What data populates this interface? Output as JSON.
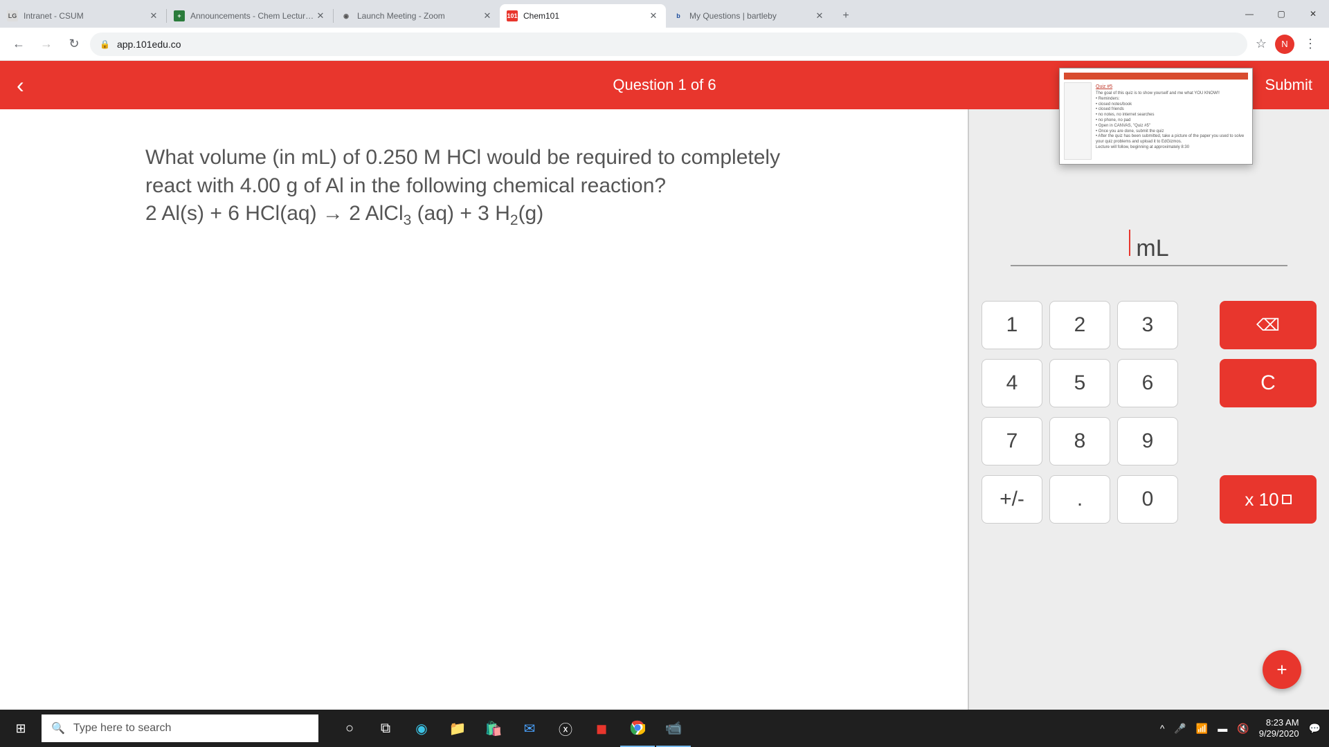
{
  "browser": {
    "tabs": [
      {
        "favicon": "LG",
        "title": "Intranet - CSUM",
        "fav_bg": "#ddd",
        "fav_color": "#555"
      },
      {
        "favicon": "+",
        "title": "Announcements - Chem Lecture…",
        "fav_bg": "#2a7b3b",
        "fav_color": "#fff"
      },
      {
        "favicon": "◉",
        "title": "Launch Meeting - Zoom",
        "fav_bg": "transparent",
        "fav_color": "#555"
      },
      {
        "favicon": "101",
        "title": "Chem101",
        "fav_bg": "#e8362d",
        "fav_color": "#fff"
      },
      {
        "favicon": "b",
        "title": "My Questions | bartleby",
        "fav_bg": "transparent",
        "fav_color": "#1a4b9c"
      }
    ],
    "active_tab": 3,
    "url": "app.101edu.co",
    "profile_letter": "N"
  },
  "header": {
    "counter": "Question 1 of 6",
    "submit": "Submit"
  },
  "question": {
    "line1": "What volume (in mL) of 0.250 M HCl would be required to completely",
    "line2": "react with 4.00 g of Al in the following chemical reaction?",
    "eq_a": "2 Al(s) + 6 HCl(aq) → 2 AlCl",
    "eq_sub1": "3",
    "eq_b": " (aq) + 3 H",
    "eq_sub2": "2",
    "eq_c": "(g)"
  },
  "answer": {
    "unit": "mL",
    "value": ""
  },
  "keypad": {
    "k1": "1",
    "k2": "2",
    "k3": "3",
    "k4": "4",
    "k5": "5",
    "k6": "6",
    "k7": "7",
    "k8": "8",
    "k9": "9",
    "k0": "0",
    "pm": "+/-",
    "dot": ".",
    "clear": "C",
    "sci": "x 10"
  },
  "pip": {
    "title": "Quiz #5",
    "lines": [
      "The goal of this quiz is to show yourself and me what YOU KNOW!!",
      "• Reminders:",
      "  • closed notes/book",
      "  • closed friends",
      "  • no notes, no internet searches",
      "  • no phone, no pad",
      "• Open in CANVAS, \"Quiz #5\"",
      "• Once you are done, submit the quiz",
      "• After the quiz has been submitted, take a picture of the paper you used to solve your quiz problems and upload it to EdGizmos.",
      "Lecture will follow, beginning at approximately 8:30"
    ]
  },
  "taskbar": {
    "search_placeholder": "Type here to search",
    "time": "8:23 AM",
    "date": "9/29/2020"
  }
}
